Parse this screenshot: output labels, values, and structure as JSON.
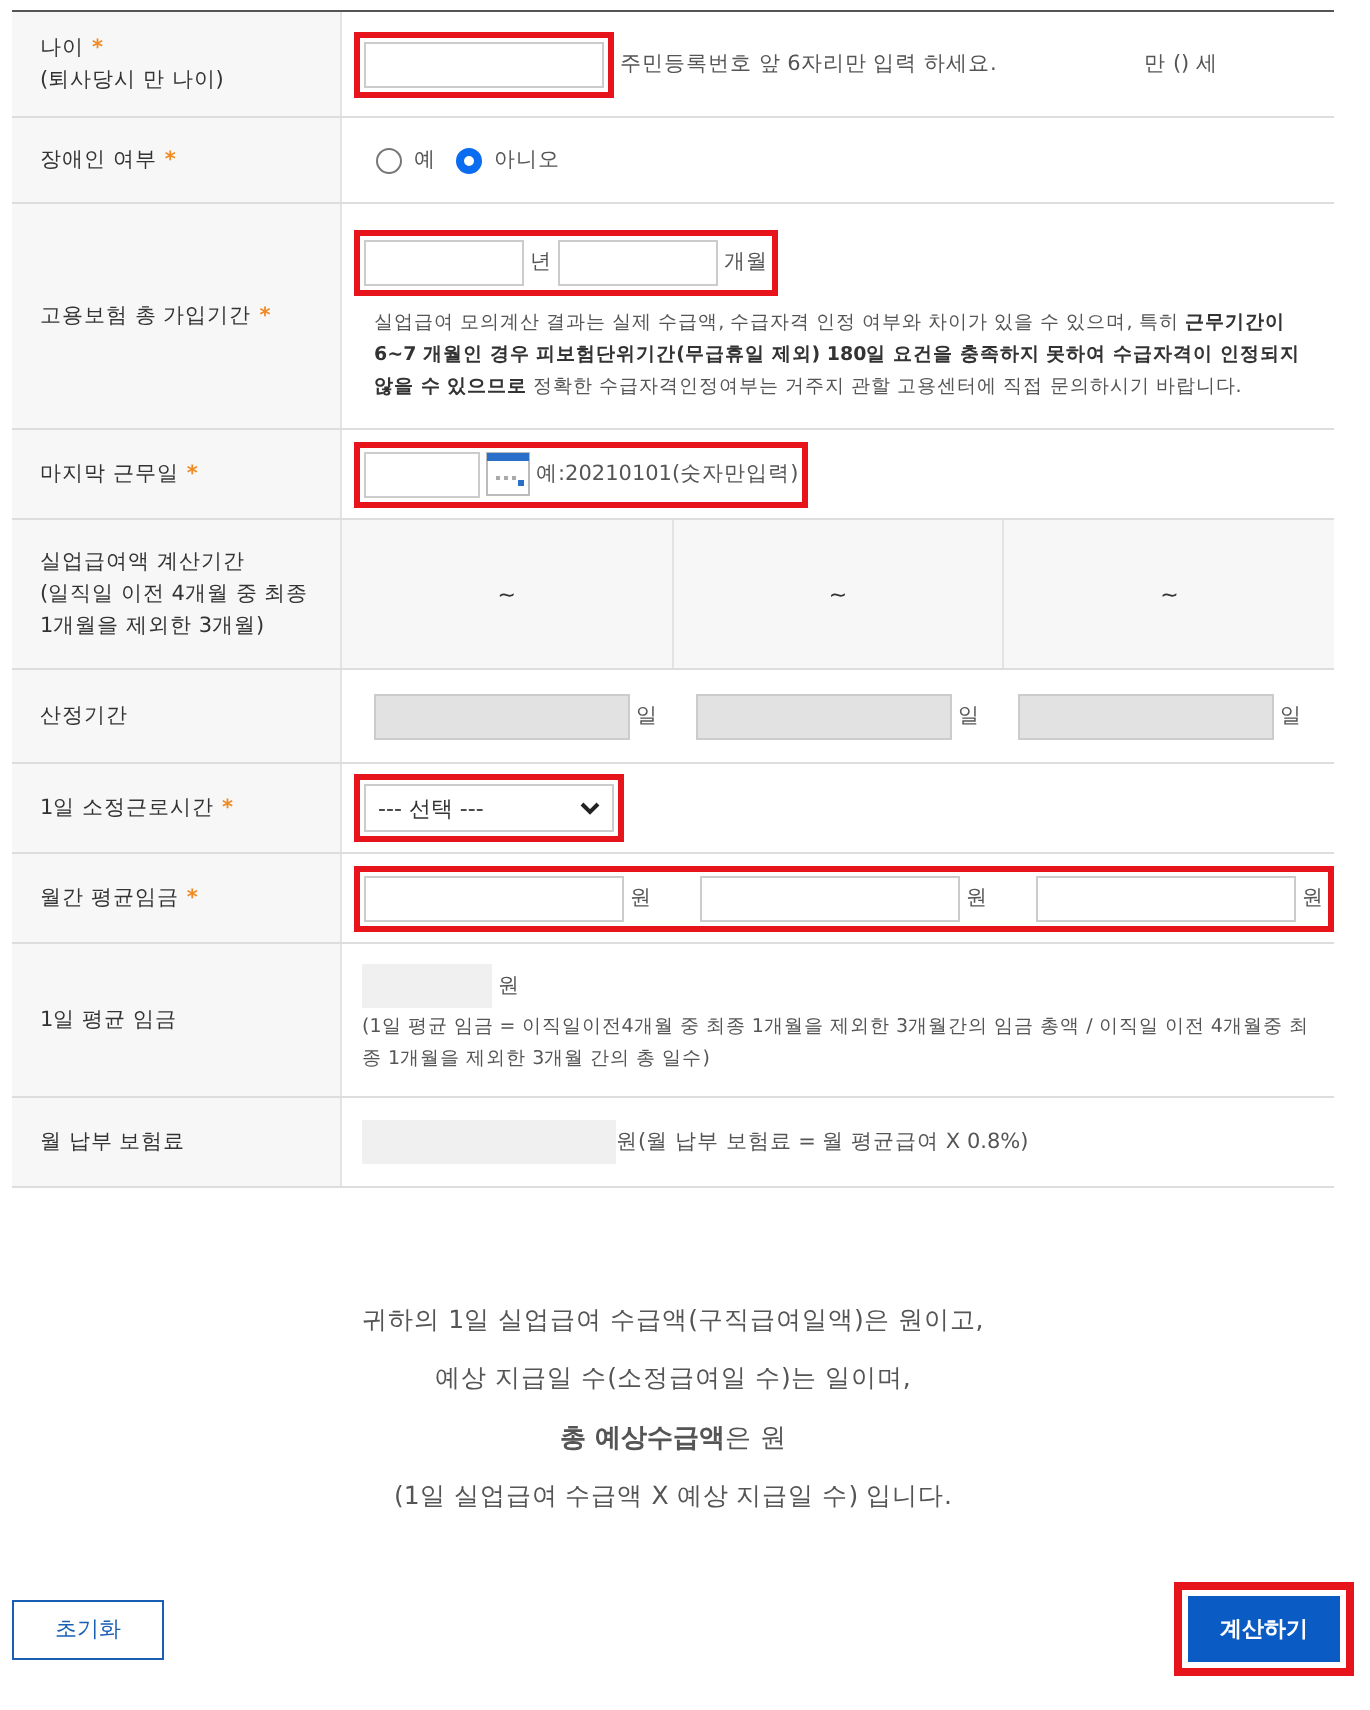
{
  "form": {
    "rows": [
      {
        "kind": "age",
        "label": "나이",
        "required_mark": "*",
        "sublabel": "(퇴사당시 만 나이)",
        "highlighted": true,
        "hint": "주민등록번호 앞 6자리만 입력 하세요.",
        "result": "만 () 세"
      },
      {
        "kind": "radio",
        "label": "장애인 여부",
        "required_mark": "*",
        "options": [
          {
            "label": "예",
            "selected": false
          },
          {
            "label": "아니오",
            "selected": true
          }
        ]
      },
      {
        "kind": "period",
        "label": "고용보험 총 가입기간",
        "required_mark": "*",
        "highlighted": true,
        "units": [
          "년",
          "개월"
        ],
        "note": "실업급여 모의계산 결과는 실제 수급액, 수급자격 인정 여부와 차이가 있을 수 있으며, 특히 **근무기간이 6~7 개월인 경우 피보험단위기간(무급휴일 제외) 180일 요건을 충족하지 못하여 수급자격이 인정되지 않을 수 있으므로** 정확한 수급자격인정여부는 거주지 관할 고용센터에 직접 문의하시기 바랍니다."
      },
      {
        "kind": "date",
        "label": "마지막 근무일",
        "required_mark": "*",
        "highlighted": true,
        "hint": "예:20210101(숫자만입력)"
      },
      {
        "kind": "range",
        "label": "실업급여액 계산기간",
        "sublabel": "(일직일 이전 4개월 중 최종 1개월을 제외한 3개월)",
        "cells": [
          "~",
          "~",
          "~"
        ]
      },
      {
        "kind": "days",
        "label": "산정기간",
        "units": [
          "일",
          "일",
          "일"
        ]
      },
      {
        "kind": "select",
        "label": "1일 소정근로시간",
        "required_mark": "*",
        "highlighted": true,
        "value": "--- 선택 ---"
      },
      {
        "kind": "wages",
        "label": "월간 평균임금",
        "required_mark": "*",
        "highlighted": true,
        "units": [
          "원",
          "원",
          "원"
        ]
      },
      {
        "kind": "daily",
        "label": "1일 평균 임금",
        "unit": "원",
        "note": "(1일 평균 임금 = 이직일이전4개월 중 최종 1개월을 제외한 3개월간의 임금 총액 / 이직일 이전 4개월중 최종 1개월을 제외한 3개월 간의 총 일수)"
      },
      {
        "kind": "premium",
        "label": "월 납부 보험료",
        "note": "원(월 납부 보험료 = 월 평균급여 X 0.8%)"
      }
    ]
  },
  "result": {
    "lines": [
      "귀하의 1일 실업급여 수급액(구직급여일액)은 원이고,",
      "예상 지급일 수(소정급여일 수)는 일이며,",
      "**총 예상수급액**은 원",
      "(1일 실업급여 수급액 X 예상 지급일 수) 입니다."
    ]
  },
  "buttons": {
    "reset": "초기화",
    "calculate": "계산하기",
    "calculate_highlighted": true
  }
}
